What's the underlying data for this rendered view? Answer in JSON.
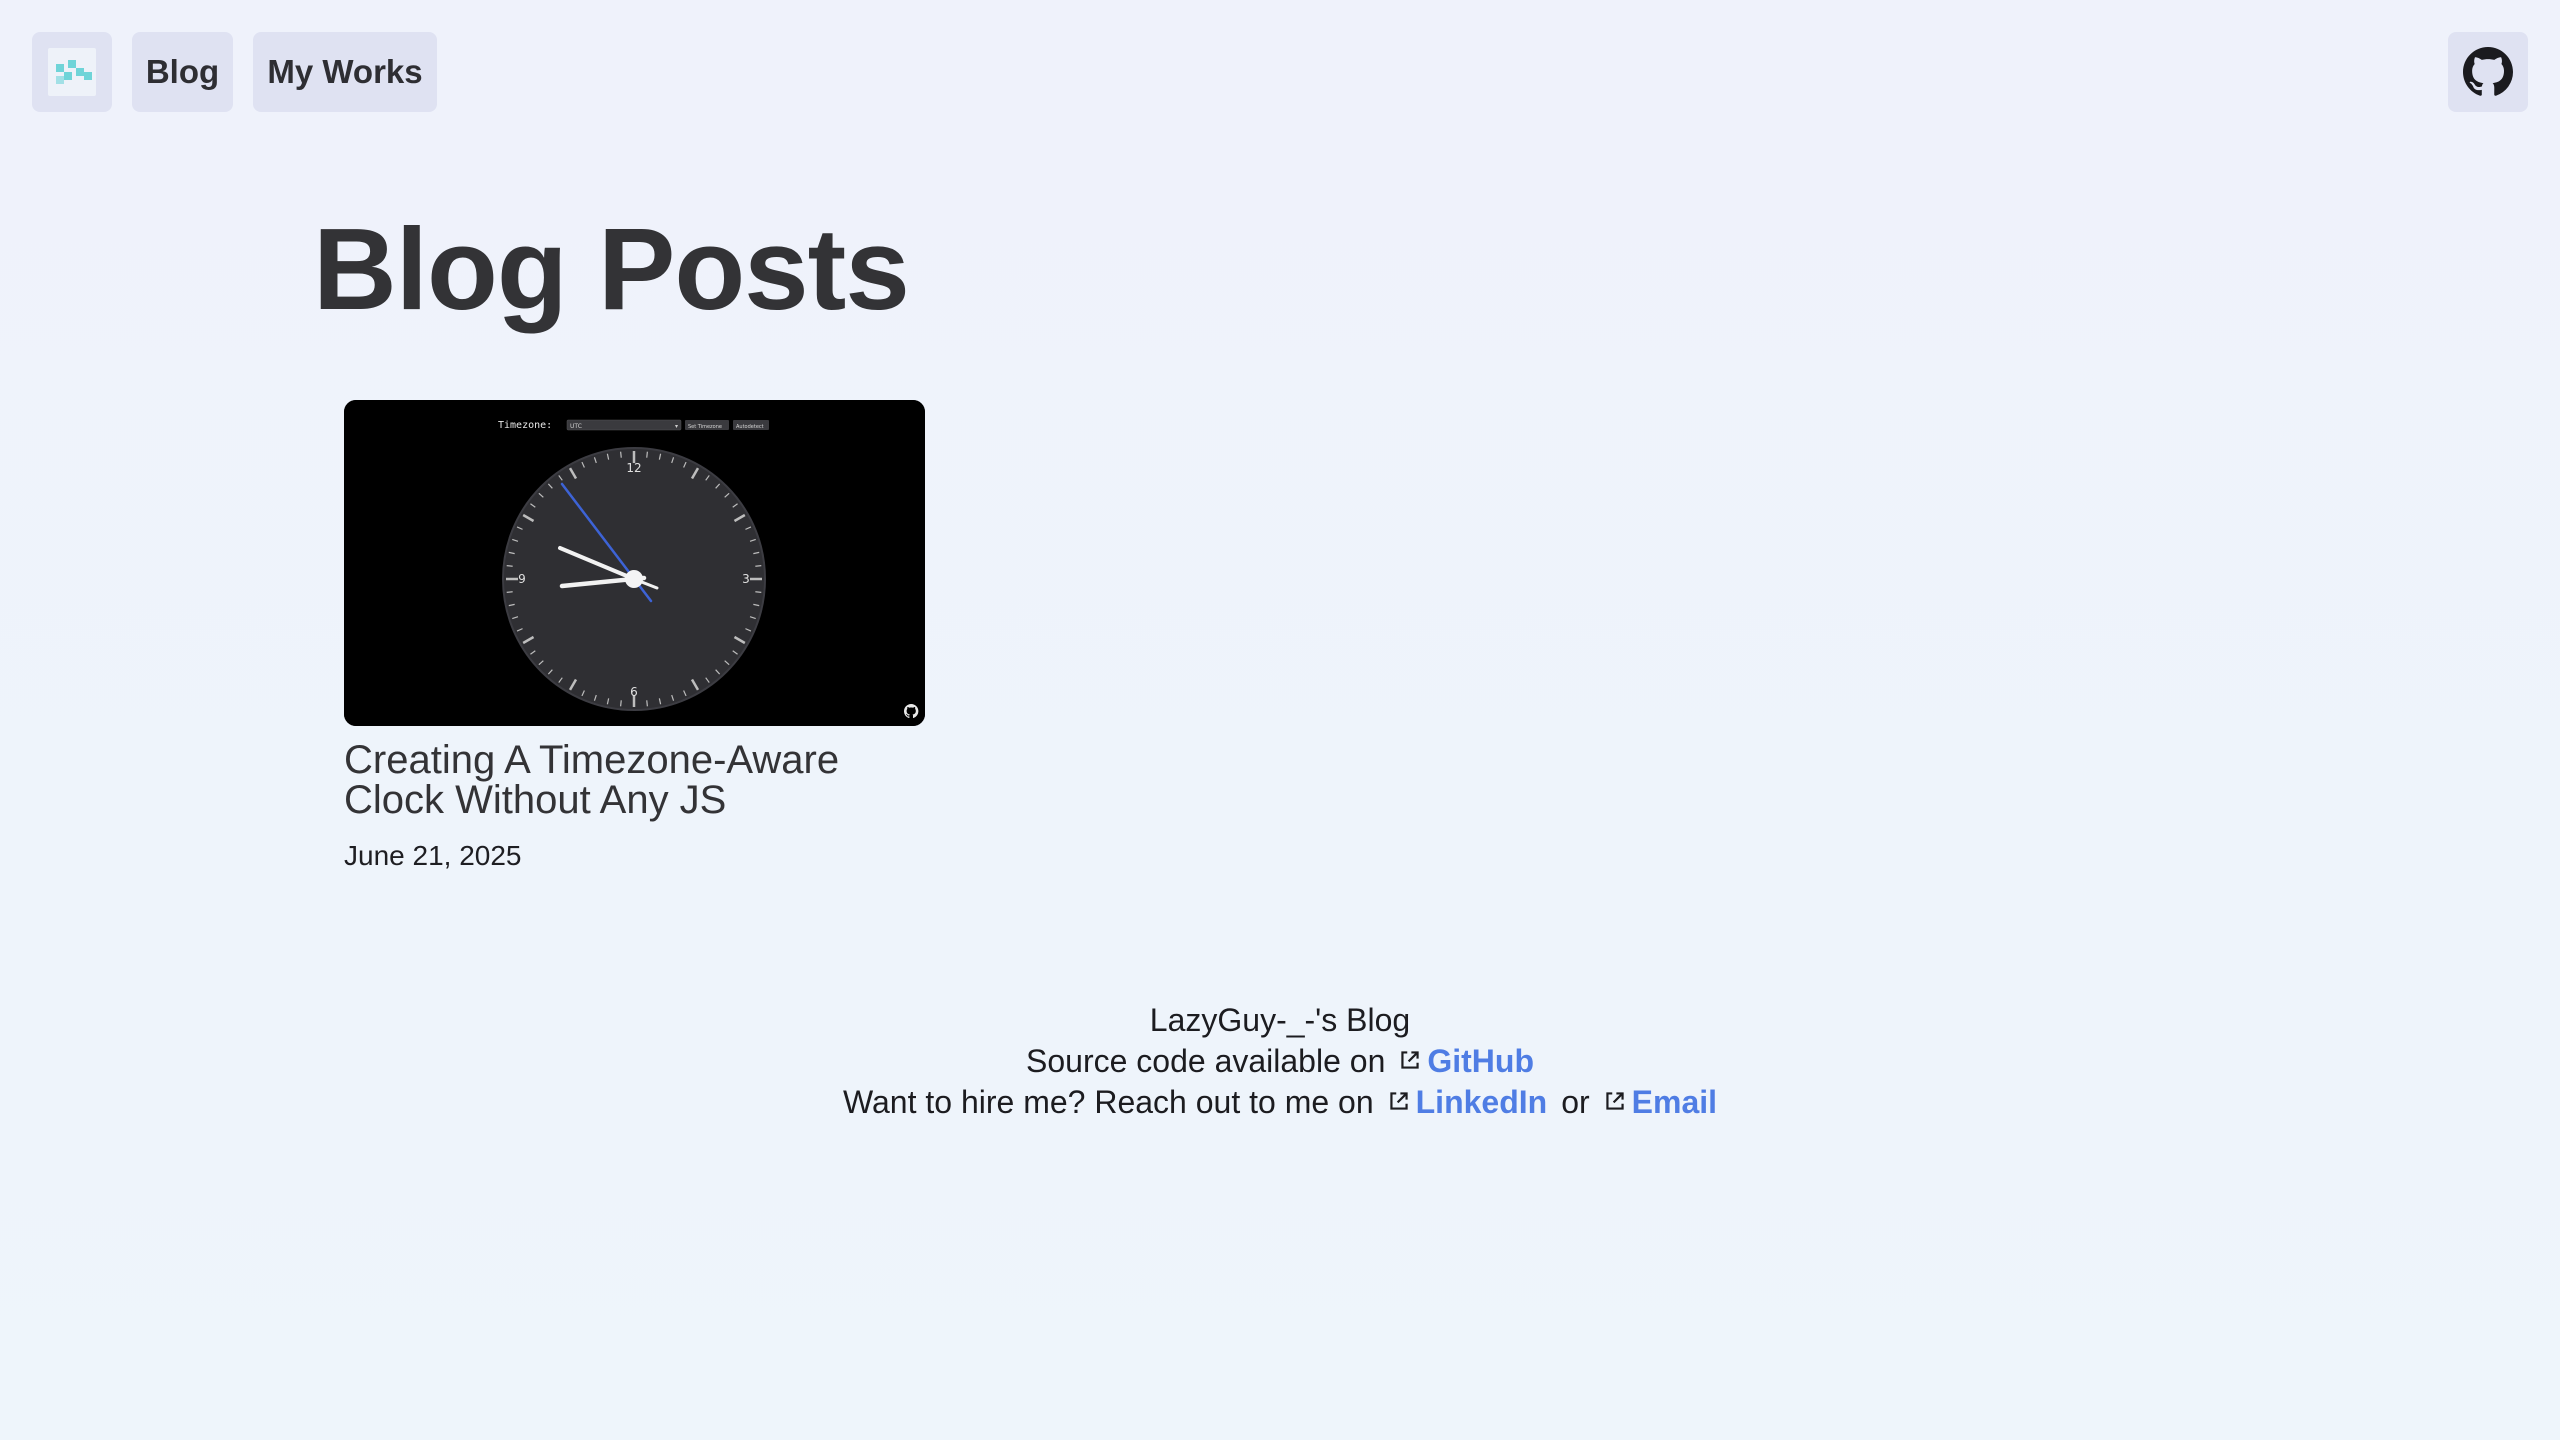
{
  "nav": {
    "blog_label": "Blog",
    "works_label": "My Works",
    "logo_icon": "pixel-logo-icon",
    "github_icon": "github-icon"
  },
  "main": {
    "title": "Blog Posts",
    "posts": [
      {
        "title": "Creating A Timezone-Aware Clock Without Any JS",
        "date": "June 21, 2025",
        "thumbnail": {
          "timezone_label": "Timezone:",
          "timezone_value": "UTC",
          "set_button": "Set Timezone",
          "auto_button": "Autodetect",
          "clock_numbers": [
            "12",
            "3",
            "6",
            "9"
          ]
        }
      }
    ]
  },
  "footer": {
    "blog_name": "LazyGuy-_-'s Blog",
    "source_text": "Source code available on",
    "github_link": "GitHub",
    "hire_text": "Want to hire me? Reach out to me on",
    "linkedin_link": "LinkedIn",
    "or_text": "or",
    "email_link": "Email"
  },
  "colors": {
    "accent_link": "#4f7de4",
    "nav_button_bg": "#dfe2f2",
    "clock_face": "#2f2f33",
    "second_hand": "#3d63d6"
  }
}
